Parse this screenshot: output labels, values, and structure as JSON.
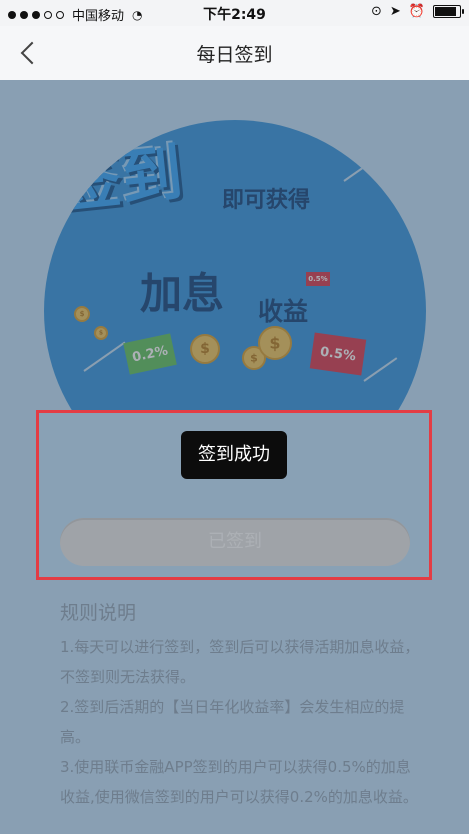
{
  "status_bar": {
    "carrier": "中国移动",
    "time": "下午2:49",
    "signal_dots_filled": 3,
    "signal_dots_empty": 2
  },
  "nav": {
    "back_icon": "chevron-left-icon",
    "title": "每日签到"
  },
  "hero": {
    "line1": "签到",
    "line2": "即可获得",
    "line3": "加息",
    "line4": "收益",
    "tag_left": "0.2%",
    "tag_right": "0.5%",
    "tag_small": "0.5%"
  },
  "toast": {
    "text": "签到成功"
  },
  "action": {
    "signed_label": "已签到"
  },
  "rules": {
    "heading": "规则说明",
    "items": [
      "1.每天可以进行签到，签到后可以获得活期加息收益，不签到则无法获得。",
      "2.签到后活期的【当日年化收益率】会发生相应的提高。",
      "3.使用联币金融APP签到的用户可以获得0.5%的加息收益,使用微信签到的用户可以获得0.2%的加息收益。"
    ]
  },
  "colors": {
    "highlight_border": "#e33c44",
    "hero_blue": "#2f93e0",
    "toast_bg": "#0c0c0c"
  }
}
